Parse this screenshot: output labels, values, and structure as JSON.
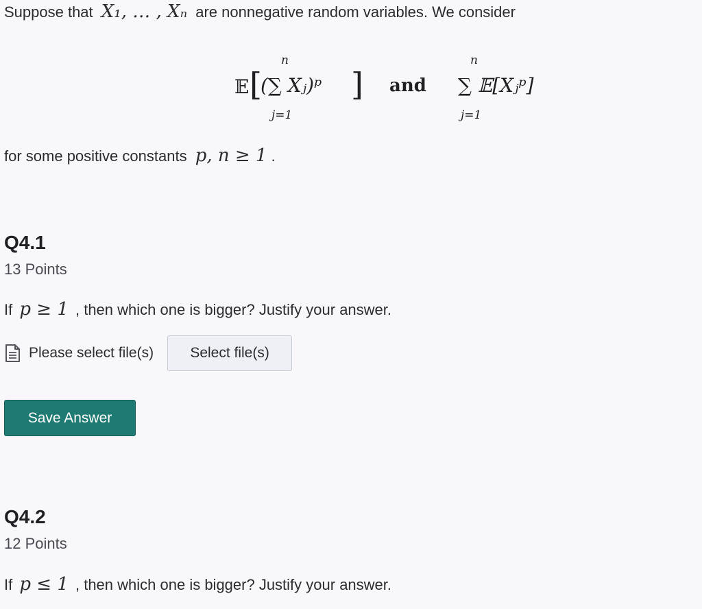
{
  "intro": {
    "text_before": "Suppose that",
    "math_vars": "X₁, … , Xₙ",
    "text_after": "are nonnegative random variables. We consider"
  },
  "display": {
    "expectation_symbol": "𝔼",
    "sum_upper": "n",
    "sum_lower": "j=1",
    "left_inner": "(∑ Xⱼ)ᵖ",
    "conjunction": "and",
    "right_inner": "∑ 𝔼[Xⱼᵖ]"
  },
  "constants": {
    "text": "for some positive constants",
    "math": "p, n ≥ 1",
    "end": "."
  },
  "questions": [
    {
      "title": "Q4.1",
      "points": "13 Points",
      "prompt_before": "If",
      "prompt_math": "p ≥ 1",
      "prompt_after": ", then which one is bigger? Justify your answer.",
      "file_label": "Please select file(s)",
      "file_button": "Select file(s)",
      "save_button": "Save Answer"
    },
    {
      "title": "Q4.2",
      "points": "12 Points",
      "prompt_before": "If",
      "prompt_math": "p ≤ 1",
      "prompt_after": ", then which one is bigger? Justify your answer."
    }
  ],
  "colors": {
    "background": "#f8f8fa",
    "save_button": "#1f7a73",
    "select_button": "#eef0f5"
  },
  "icons": {
    "file": "document-icon"
  }
}
